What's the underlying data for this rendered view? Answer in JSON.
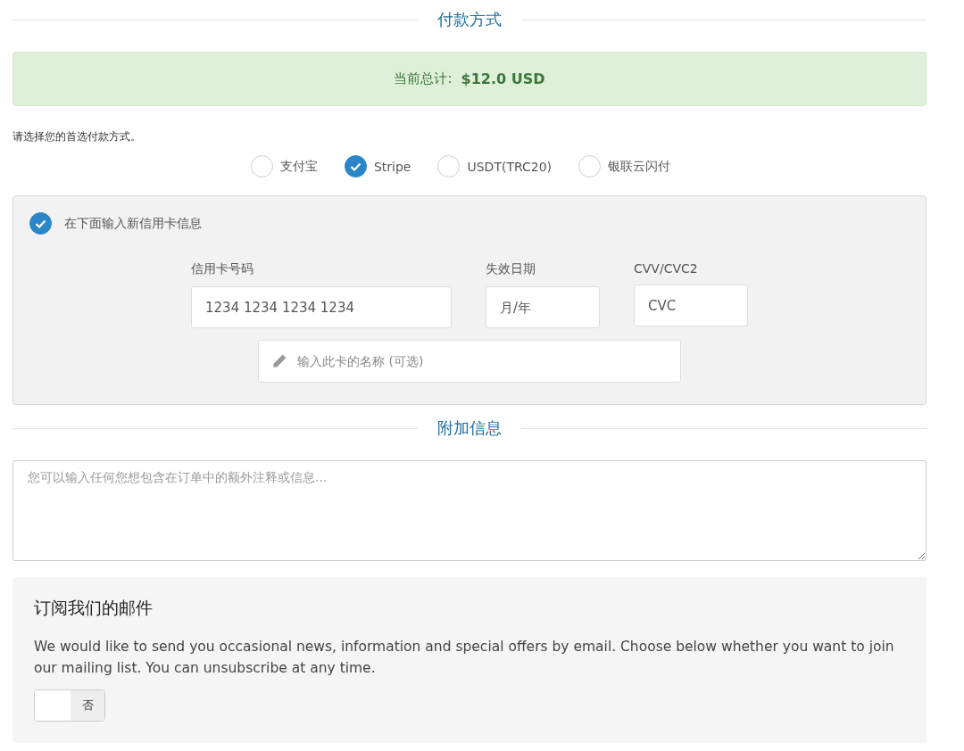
{
  "payment_section": {
    "title": "付款方式"
  },
  "total": {
    "label": "当前总计:",
    "amount": "$12.0 USD"
  },
  "payment_prompt": "请选择您的首选付款方式。",
  "payment_methods": [
    {
      "label": "支付宝",
      "selected": false
    },
    {
      "label": "Stripe",
      "selected": true
    },
    {
      "label": "USDT(TRC20)",
      "selected": false
    },
    {
      "label": "银联云闪付",
      "selected": false
    }
  ],
  "card_panel": {
    "new_card_label": "在下面输入新信用卡信息",
    "new_card_checked": true,
    "fields": [
      {
        "label": "信用卡号码",
        "placeholder": "1234 1234 1234 1234",
        "kind": "number"
      },
      {
        "label": "失效日期",
        "placeholder": "月/年",
        "kind": "expiry"
      },
      {
        "label": "CVV/CVC2",
        "placeholder": "CVC",
        "kind": "cvc"
      }
    ],
    "name_placeholder": "输入此卡的名称 (可选)"
  },
  "notes_section": {
    "title": "附加信息",
    "placeholder": "您可以输入任何您想包含在订单中的额外注释或信息..."
  },
  "subscribe": {
    "title": "订阅我们的邮件",
    "text": "We would like to send you occasional news, information and special offers by email. Choose below whether you want to join our mailing list. You can unsubscribe at any time.",
    "toggle": {
      "on": false,
      "label": "否"
    }
  }
}
